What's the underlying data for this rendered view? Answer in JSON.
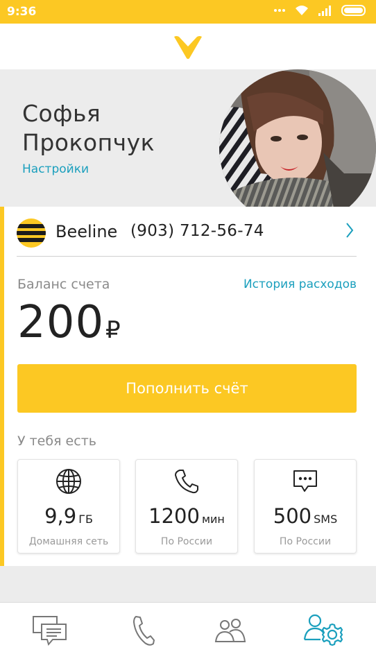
{
  "status_bar": {
    "time": "9:36",
    "icons": [
      "more-dots-icon",
      "wifi-icon",
      "signal-icon",
      "battery-icon"
    ]
  },
  "header": {
    "logo_icon": "beeline-v-logo-icon"
  },
  "profile": {
    "first_name": "Софья",
    "last_name": "Прокопчук",
    "settings_link": "Настройки"
  },
  "account": {
    "operator": "Beeline",
    "phone": "(903) 712-56-74",
    "balance_label": "Баланс счета",
    "history_link": "История расходов",
    "balance_value": "200",
    "currency": "₽",
    "topup_label": "Пополнить счёт",
    "have_label": "У тебя есть"
  },
  "tiles": [
    {
      "icon": "globe-icon",
      "value": "9,9",
      "unit": "ГБ",
      "caption": "Домашняя сеть"
    },
    {
      "icon": "phone-icon",
      "value": "1200",
      "unit": "мин",
      "caption": "По России"
    },
    {
      "icon": "sms-icon",
      "value": "500",
      "unit": "SMS",
      "caption": "По России"
    }
  ],
  "bottom_nav": [
    {
      "icon": "messages-icon",
      "active": false
    },
    {
      "icon": "phone-icon",
      "active": false
    },
    {
      "icon": "contacts-icon",
      "active": false
    },
    {
      "icon": "profile-settings-icon",
      "active": true
    }
  ],
  "colors": {
    "brand_yellow": "#fcc823",
    "link_blue": "#1a9fbd",
    "text_gray": "#8a8a8a"
  }
}
